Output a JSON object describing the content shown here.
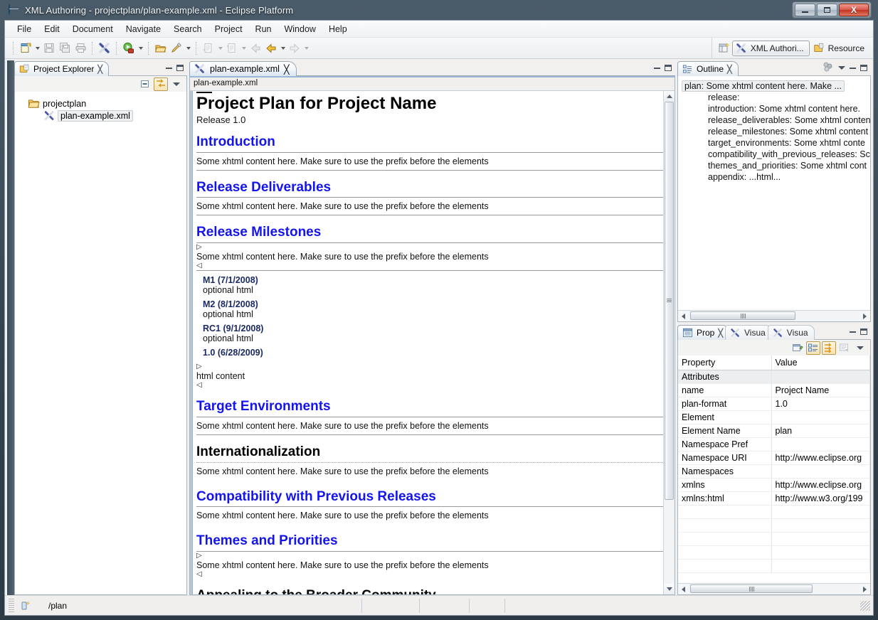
{
  "window": {
    "title": "XML Authoring - projectplan/plan-example.xml - Eclipse Platform",
    "icon": "eclipse-globe-icon",
    "minimize_label": "Minimize",
    "maximize_label": "Maximize",
    "close_label": "X"
  },
  "menubar": {
    "items": [
      "File",
      "Edit",
      "Document",
      "Navigate",
      "Search",
      "Project",
      "Run",
      "Window",
      "Help"
    ]
  },
  "toolbar": {
    "groups": [
      {
        "buttons": [
          {
            "name": "new-wizard-icon",
            "label": "New",
            "dropdown": true,
            "enabled": true
          },
          {
            "name": "save-icon",
            "label": "Save",
            "dropdown": false,
            "enabled": false
          },
          {
            "name": "save-all-icon",
            "label": "Save All",
            "dropdown": false,
            "enabled": false
          },
          {
            "name": "print-icon",
            "label": "Print",
            "dropdown": false,
            "enabled": false
          }
        ]
      },
      {
        "buttons": [
          {
            "name": "xml-authoring-icon",
            "label": "XML Authoring",
            "dropdown": false,
            "enabled": true
          }
        ]
      },
      {
        "buttons": [
          {
            "name": "run-icon",
            "label": "Run",
            "dropdown": true,
            "enabled": true
          }
        ]
      },
      {
        "buttons": [
          {
            "name": "open-resource-icon",
            "label": "Open Resource",
            "dropdown": false,
            "enabled": true
          },
          {
            "name": "search-marker-icon",
            "label": "Last Edit Location",
            "dropdown": true,
            "enabled": true
          }
        ]
      },
      {
        "buttons": [
          {
            "name": "next-annotation-icon",
            "label": "Next Annotation",
            "dropdown": true,
            "enabled": false
          },
          {
            "name": "previous-annotation-icon",
            "label": "Previous Annotation",
            "dropdown": true,
            "enabled": false
          },
          {
            "name": "back-history-icon",
            "label": "Back",
            "dropdown": false,
            "enabled": false
          },
          {
            "name": "forward-history-icon",
            "label": "Forward",
            "dropdown": true,
            "enabled": true
          },
          {
            "name": "forward-nav-icon",
            "label": "Forward",
            "dropdown": true,
            "enabled": false
          }
        ]
      }
    ]
  },
  "perspective_bar": {
    "open_perspective_label": "Open Perspective",
    "items": [
      {
        "label": "XML Authori...",
        "icon": "xml-authoring-icon",
        "active": true
      },
      {
        "label": "Resource",
        "icon": "resource-perspective-icon",
        "active": false
      }
    ]
  },
  "project_explorer": {
    "tab_label": "Project Explorer",
    "tab_icon": "project-explorer-icon",
    "toolbar": [
      {
        "name": "collapse-all-icon",
        "label": "Collapse All"
      },
      {
        "name": "link-with-editor-icon",
        "label": "Link with Editor",
        "toggled": true
      },
      {
        "name": "view-menu-icon",
        "label": "View Menu"
      }
    ],
    "tree": [
      {
        "label": "projectplan",
        "icon": "folder-icon",
        "level": 0,
        "selected": false
      },
      {
        "label": "plan-example.xml",
        "icon": "xml-file-icon",
        "level": 1,
        "selected": true
      }
    ]
  },
  "editor": {
    "tab_label": "plan-example.xml",
    "tab_icon": "xml-file-icon",
    "tab_close": "✕",
    "breadcrumb": "plan-example.xml",
    "document": {
      "title": "Project Plan for Project Name",
      "subtitle": "Release 1.0",
      "body_text": "Some xhtml content here. Make sure to use the prefix before the elements",
      "blocks": [
        {
          "kind": "heading",
          "text": "Introduction",
          "color": "blue"
        },
        {
          "kind": "para"
        },
        {
          "kind": "heading",
          "text": "Release Deliverables",
          "color": "blue"
        },
        {
          "kind": "para"
        },
        {
          "kind": "heading",
          "text": "Release Milestones",
          "color": "blue"
        },
        {
          "kind": "wrapped-para"
        },
        {
          "kind": "milestones"
        },
        {
          "kind": "wrapped-html",
          "text": "html content"
        },
        {
          "kind": "heading",
          "text": "Target Environments",
          "color": "blue"
        },
        {
          "kind": "para"
        },
        {
          "kind": "heading",
          "text": "Internationalization",
          "color": "black"
        },
        {
          "kind": "para-dotted"
        },
        {
          "kind": "heading",
          "text": "Compatibility with Previous Releases",
          "color": "blue"
        },
        {
          "kind": "para"
        },
        {
          "kind": "heading",
          "text": "Themes and Priorities",
          "color": "blue"
        },
        {
          "kind": "wrapped-para"
        },
        {
          "kind": "heading",
          "text": "Appealing to the Broader Community",
          "color": "black"
        }
      ],
      "milestones": [
        {
          "name": "M1 (7/1/2008)",
          "desc": "optional html"
        },
        {
          "name": "M2 (8/1/2008)",
          "desc": "optional html"
        },
        {
          "name": "RC1 (9/1/2008)",
          "desc": "optional html"
        },
        {
          "name": "1.0 (6/28/2009)",
          "desc": ""
        }
      ],
      "open_marker": "▷",
      "close_marker": "◁"
    }
  },
  "outline": {
    "tab_label": "Outline",
    "tab_icon": "outline-icon",
    "toolbar": [
      {
        "name": "sort-icon",
        "label": "Sort"
      },
      {
        "name": "view-menu-icon",
        "label": "View Menu"
      }
    ],
    "rows": [
      {
        "label": "plan: Some xhtml content here. Make ...",
        "level": 0,
        "selected": true
      },
      {
        "label": "release:",
        "level": 1,
        "selected": false
      },
      {
        "label": "introduction: Some xhtml content here.",
        "level": 1,
        "selected": false
      },
      {
        "label": "release_deliverables: Some xhtml conten",
        "level": 1,
        "selected": false
      },
      {
        "label": "release_milestones: Some xhtml content",
        "level": 1,
        "selected": false
      },
      {
        "label": "target_environments: Some xhtml conte",
        "level": 1,
        "selected": false
      },
      {
        "label": "compatibility_with_previous_releases: Sc",
        "level": 1,
        "selected": false
      },
      {
        "label": "themes_and_priorities: Some xhtml cont",
        "level": 1,
        "selected": false
      },
      {
        "label": "appendix: ...html...",
        "level": 1,
        "selected": false
      }
    ]
  },
  "properties": {
    "tabs": [
      {
        "label": "Prop",
        "icon": "properties-icon",
        "active": true,
        "closable": true
      },
      {
        "label": "Visua",
        "icon": "xml-authoring-icon",
        "active": false,
        "closable": false
      },
      {
        "label": "Visua",
        "icon": "xml-authoring-icon",
        "active": false,
        "closable": false
      }
    ],
    "toolbar": [
      {
        "name": "new-property-icon",
        "label": "New"
      },
      {
        "name": "show-categories-icon",
        "label": "Show Categories",
        "toggled": true
      },
      {
        "name": "show-advanced-icon",
        "label": "Show Advanced Properties",
        "toggled": true
      },
      {
        "name": "restore-default-icon",
        "label": "Restore Default Value",
        "enabled": false
      },
      {
        "name": "view-menu-icon",
        "label": "View Menu"
      }
    ],
    "columns": [
      "Property",
      "Value"
    ],
    "rows": [
      {
        "property": "Attributes",
        "value": "",
        "indent": 1,
        "category": true
      },
      {
        "property": "name",
        "value": "Project Name",
        "indent": 2,
        "category": false
      },
      {
        "property": "plan-format",
        "value": "1.0",
        "indent": 2,
        "category": false
      },
      {
        "property": "Element",
        "value": "",
        "indent": 1,
        "category": false
      },
      {
        "property": "Element Name",
        "value": "plan",
        "indent": 2,
        "category": false
      },
      {
        "property": "Namespace Pref",
        "value": "",
        "indent": 2,
        "category": false
      },
      {
        "property": "Namespace URI",
        "value": "http://www.eclipse.org",
        "indent": 2,
        "category": false
      },
      {
        "property": "Namespaces",
        "value": "",
        "indent": 1,
        "category": false
      },
      {
        "property": "xmlns",
        "value": "http://www.eclipse.org",
        "indent": 2,
        "category": false
      },
      {
        "property": "xmlns:html",
        "value": "http://www.w3.org/199",
        "indent": 2,
        "category": false
      },
      {
        "property": "",
        "value": "",
        "indent": 0,
        "category": false
      },
      {
        "property": "",
        "value": "",
        "indent": 0,
        "category": false
      },
      {
        "property": "",
        "value": "",
        "indent": 0,
        "category": false
      },
      {
        "property": "",
        "value": "",
        "indent": 0,
        "category": false
      },
      {
        "property": "",
        "value": "",
        "indent": 0,
        "category": false
      }
    ]
  },
  "statusbar": {
    "icon": "xpath-location-icon",
    "text": "/plan"
  },
  "colors": {
    "heading_blue": "#1414ee",
    "milestone_navy": "#1a2a63",
    "selection_bg": "#eef0f2",
    "tab_active_bg": "#d9e6f2",
    "window_chrome": "#3b4b58"
  }
}
